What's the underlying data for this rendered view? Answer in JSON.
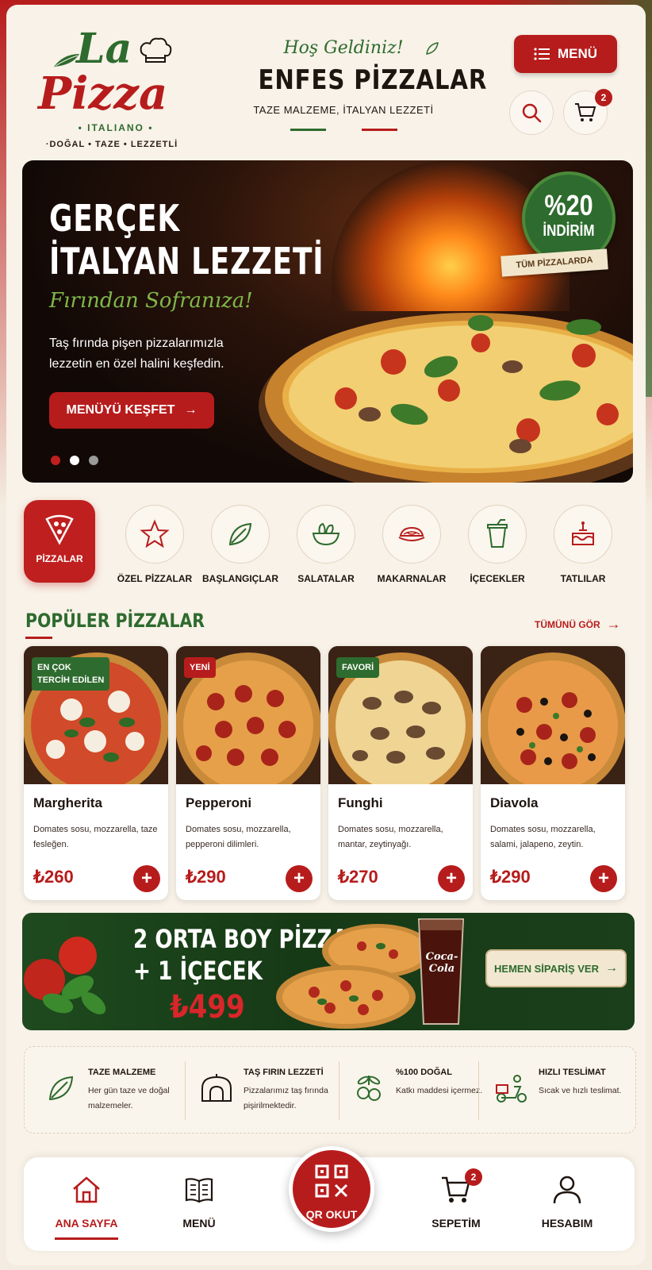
{
  "brand": {
    "line1": "La",
    "line2": "Pizza",
    "sub": "• ITALIANO •",
    "tagline": "·DOĞAL • TAZE • LEZZETLİ"
  },
  "header": {
    "welcome": "Hoş Geldiniz!",
    "title": "ENFES PİZZALAR",
    "subtitle": "TAZE MALZEME, İTALYAN LEZZETİ",
    "menu_label": "MENÜ",
    "cart_count": "2"
  },
  "hero": {
    "title_line1": "GERÇEK",
    "title_line2": "İTALYAN LEZZETİ",
    "script": "Fırından Sofranıza!",
    "description": "Taş fırında pişen pizzalarımızla lezzetin en özel halini keşfedin.",
    "cta": "MENÜYÜ KEŞFET",
    "discount_pct": "%20",
    "discount_label": "İNDİRİM",
    "discount_ribbon": "TÜM PİZZALARDA",
    "slide_count": 3,
    "active_slide": 1
  },
  "categories": [
    {
      "label": "PİZZALAR",
      "icon": "pizza-slice-icon",
      "active": true
    },
    {
      "label": "ÖZEL PİZZALAR",
      "icon": "star-icon"
    },
    {
      "label": "BAŞLANGIÇLAR",
      "icon": "leaf-icon"
    },
    {
      "label": "SALATALAR",
      "icon": "salad-bowl-icon"
    },
    {
      "label": "MAKARNALAR",
      "icon": "pasta-icon"
    },
    {
      "label": "İÇECEKLER",
      "icon": "drink-cup-icon"
    },
    {
      "label": "TATLILAR",
      "icon": "cake-icon"
    }
  ],
  "popular": {
    "title": "POPÜLER PİZZALAR",
    "see_all": "TÜMÜNÜ GÖR",
    "items": [
      {
        "tag": "EN ÇOK TERCİH EDİLEN",
        "tag_line1": "EN ÇOK",
        "tag_line2": "TERCİH EDİLEN",
        "tag_color": "green",
        "name": "Margherita",
        "desc": "Domates sosu, mozzarella, taze fesleğen.",
        "price": "₺260"
      },
      {
        "tag": "YENİ",
        "tag_color": "red",
        "name": "Pepperoni",
        "desc": "Domates sosu, mozzarella, pepperoni dilimleri.",
        "price": "₺290"
      },
      {
        "tag": "FAVORİ",
        "tag_color": "green",
        "name": "Funghi",
        "desc": "Domates sosu, mozzarella, mantar, zeytinyağı.",
        "price": "₺270"
      },
      {
        "tag": "",
        "tag_color": "",
        "name": "Diavola",
        "desc": "Domates sosu, mozzarella, salami, jalapeno, zeytin.",
        "price": "₺290"
      }
    ]
  },
  "promo": {
    "line1": "2 ORTA BOY PİZZA",
    "line2": "+ 1 İÇECEK",
    "price": "₺499",
    "cta": "HEMEN SİPARİŞ VER",
    "drink_brand": "Coca-Cola"
  },
  "features": [
    {
      "icon": "leaf-icon",
      "title": "TAZE MALZEME",
      "desc": "Her gün taze ve doğal malzemeler."
    },
    {
      "icon": "oven-icon",
      "title": "TAŞ FIRIN LEZZETİ",
      "desc": "Pizzalarımız taş fırında pişirilmektedir."
    },
    {
      "icon": "olive-icon",
      "title": "%100 DOĞAL",
      "desc": "Katkı maddesi içermez."
    },
    {
      "icon": "scooter-icon",
      "title": "HIZLI TESLİMAT",
      "desc": "Sıcak ve hızlı teslimat."
    }
  ],
  "bottom_nav": {
    "home": "ANA SAYFA",
    "menu": "MENÜ",
    "qr": "QR OKUT",
    "cart": "SEPETİM",
    "cart_count": "2",
    "account": "HESABIM"
  },
  "colors": {
    "primary_red": "#b71c1c",
    "primary_green": "#2e6b2e",
    "cream": "#f8f2e8"
  }
}
